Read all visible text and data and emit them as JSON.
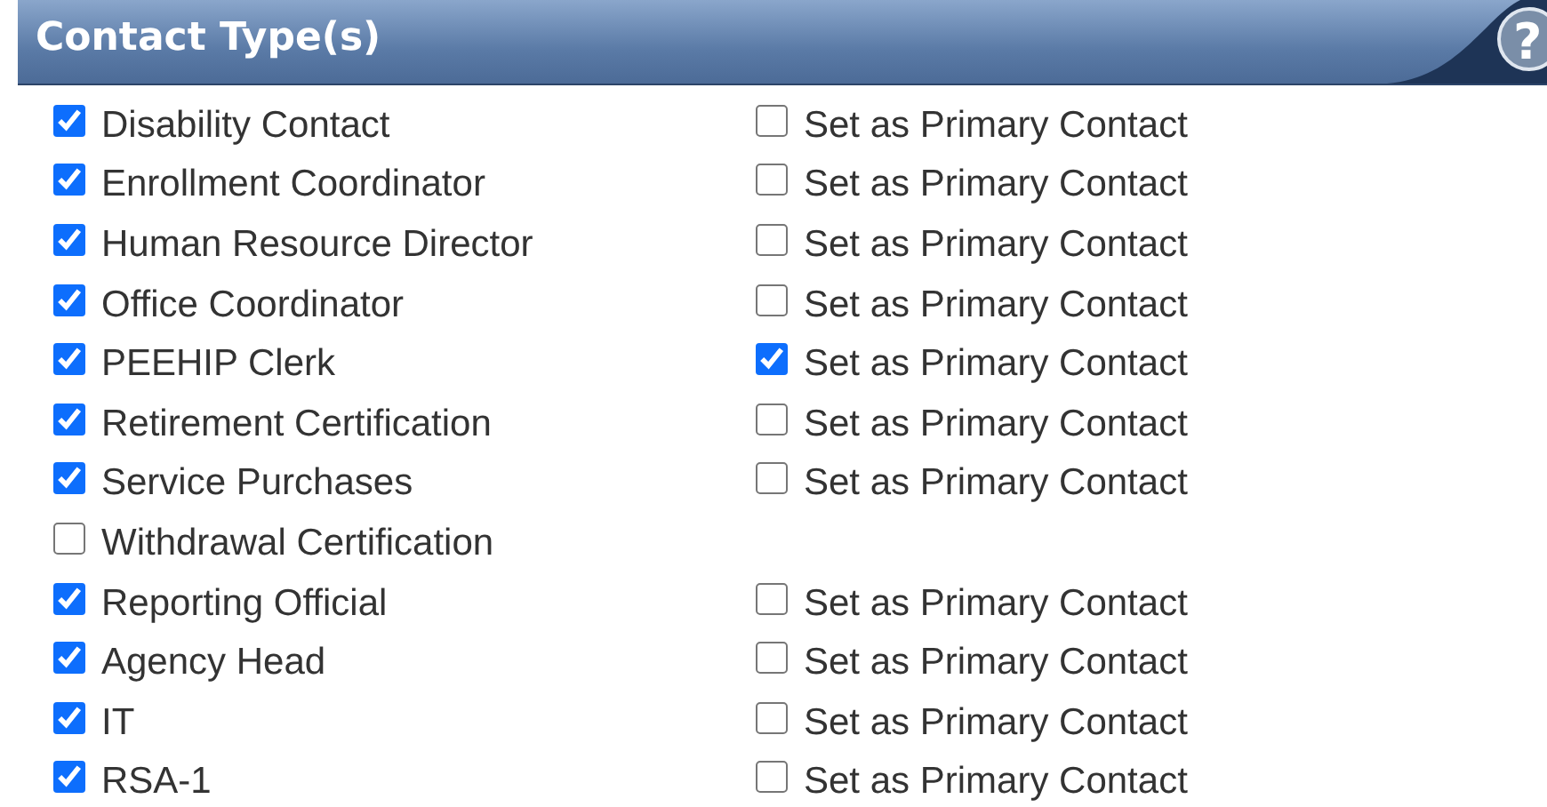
{
  "header": {
    "title": "Contact Type(s)",
    "help_button": "?"
  },
  "contact_types": [
    {
      "label": "Disability Contact",
      "checked": true,
      "primary": {
        "label": "Set as Primary Contact",
        "checked": false
      }
    },
    {
      "label": "Enrollment Coordinator",
      "checked": true,
      "primary": {
        "label": "Set as Primary Contact",
        "checked": false
      }
    },
    {
      "label": "Human Resource Director",
      "checked": true,
      "primary": {
        "label": "Set as Primary Contact",
        "checked": false
      }
    },
    {
      "label": "Office Coordinator",
      "checked": true,
      "primary": {
        "label": "Set as Primary Contact",
        "checked": false
      }
    },
    {
      "label": "PEEHIP Clerk",
      "checked": true,
      "primary": {
        "label": "Set as Primary Contact",
        "checked": true
      }
    },
    {
      "label": "Retirement Certification",
      "checked": true,
      "primary": {
        "label": "Set as Primary Contact",
        "checked": false
      }
    },
    {
      "label": "Service Purchases",
      "checked": true,
      "primary": {
        "label": "Set as Primary Contact",
        "checked": false
      }
    },
    {
      "label": "Withdrawal Certification",
      "checked": false
    },
    {
      "label": "Reporting Official",
      "checked": true,
      "primary": {
        "label": "Set as Primary Contact",
        "checked": false
      }
    },
    {
      "label": "Agency Head",
      "checked": true,
      "primary": {
        "label": "Set as Primary Contact",
        "checked": false
      }
    },
    {
      "label": "IT",
      "checked": true,
      "primary": {
        "label": "Set as Primary Contact",
        "checked": false
      }
    },
    {
      "label": "RSA-1",
      "checked": true,
      "primary": {
        "label": "Set as Primary Contact",
        "checked": false
      }
    }
  ]
}
